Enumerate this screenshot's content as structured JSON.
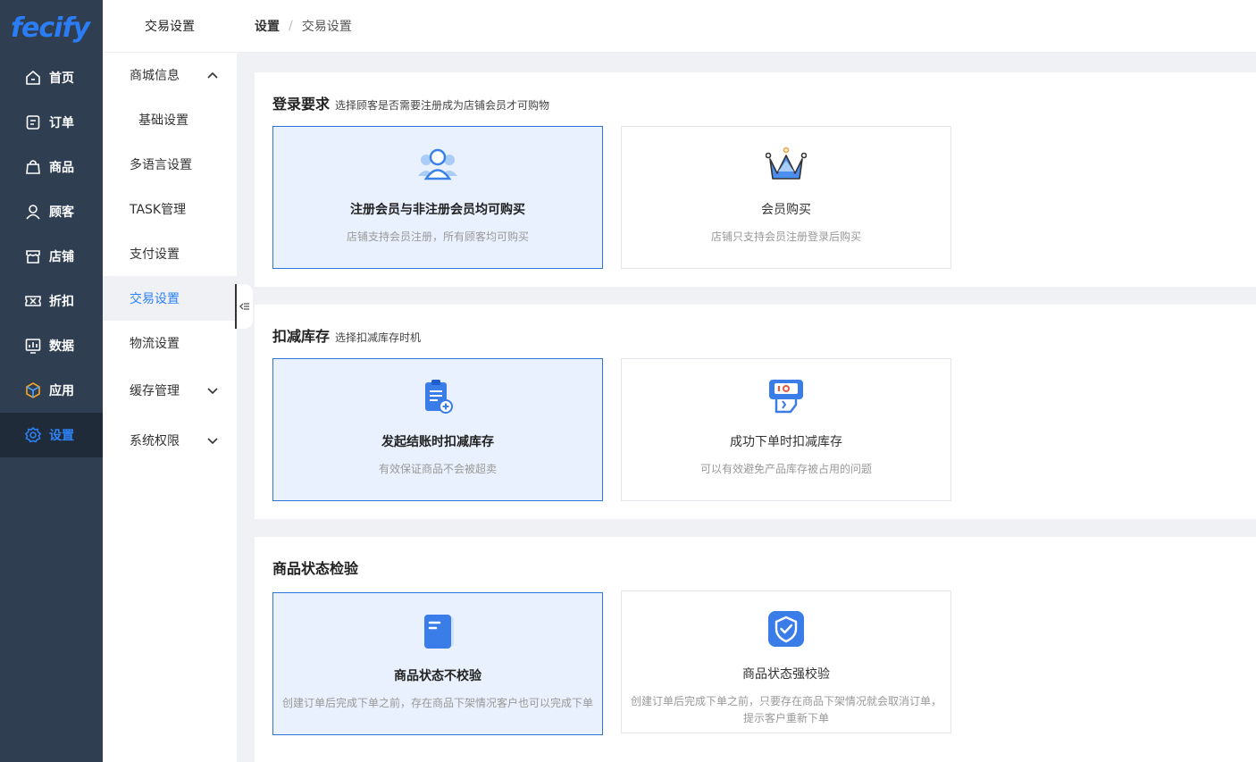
{
  "logo": "fecify",
  "nav": [
    {
      "label": "首页",
      "icon": "home-icon"
    },
    {
      "label": "订单",
      "icon": "order-icon"
    },
    {
      "label": "商品",
      "icon": "bag-icon"
    },
    {
      "label": "顾客",
      "icon": "user-icon"
    },
    {
      "label": "店铺",
      "icon": "store-icon"
    },
    {
      "label": "折扣",
      "icon": "coupon-icon"
    },
    {
      "label": "数据",
      "icon": "chart-icon"
    },
    {
      "label": "应用",
      "icon": "cube-icon"
    },
    {
      "label": "设置",
      "icon": "gear-icon",
      "active": true
    }
  ],
  "subnav": {
    "title": "交易设置",
    "items": [
      {
        "label": "商城信息",
        "chevron": "up"
      },
      {
        "label": "基础设置",
        "child": true
      },
      {
        "label": "多语言设置"
      },
      {
        "label": "TASK管理"
      },
      {
        "label": "支付设置"
      },
      {
        "label": "交易设置",
        "active": true
      },
      {
        "label": "物流设置"
      },
      {
        "label": "缓存管理",
        "chevron": "down"
      },
      {
        "label": "系统权限",
        "chevron": "down"
      }
    ]
  },
  "breadcrumb": {
    "root": "设置",
    "sep": "/",
    "current": "交易设置"
  },
  "sections": [
    {
      "title": "登录要求",
      "subtitle": "选择顾客是否需要注册成为店铺会员才可购物",
      "cards": [
        {
          "title": "注册会员与非注册会员均可购买",
          "desc": "店铺支持会员注册，所有顾客均可购买",
          "icon": "users-icon",
          "selected": true
        },
        {
          "title": "会员购买",
          "desc": "店铺只支持会员注册登录后购买",
          "icon": "crown-icon",
          "selected": false
        }
      ]
    },
    {
      "title": "扣减库存",
      "subtitle": "选择扣减库存时机",
      "cards": [
        {
          "title": "发起结账时扣减库存",
          "desc": "有效保证商品不会被超卖",
          "icon": "clipboard-icon",
          "selected": true
        },
        {
          "title": "成功下单时扣减库存",
          "desc": "可以有效避免产品库存被占用的问题",
          "icon": "pos-terminal-icon",
          "selected": false
        }
      ]
    },
    {
      "title": "商品状态检验",
      "subtitle": "",
      "cards": [
        {
          "title": "商品状态不校验",
          "desc": "创建订单后完成下单之前，存在商品下架情况客户也可以完成下单",
          "icon": "document-icon",
          "selected": true
        },
        {
          "title": "商品状态强校验",
          "desc": "创建订单后完成下单之前，只要存在商品下架情况就会取消订单，提示客户重新下单",
          "icon": "shield-check-icon",
          "selected": false
        }
      ]
    }
  ],
  "colors": {
    "accent": "#2d82f7",
    "nav_bg": "#2f3e50",
    "nav_active_bg": "#1f2b38",
    "selected_card_bg": "#e8f1fd",
    "selected_card_border": "#2d74d9"
  }
}
